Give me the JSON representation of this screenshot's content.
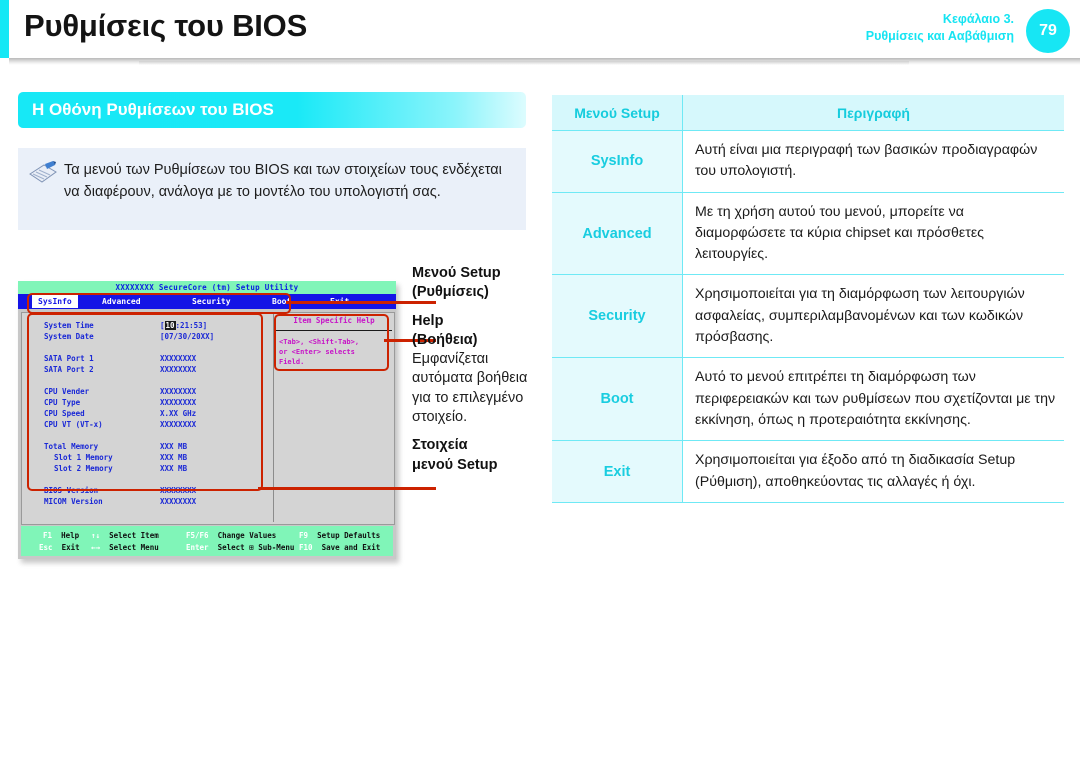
{
  "header": {
    "title": "Ρυθμίσεις του BIOS",
    "chapter": "Κεφάλαιο 3.",
    "subtitle": "Ρυθμίσεις και Ααβάθμιση",
    "page_number": "79",
    "accent_color": "#17e6f4"
  },
  "section": {
    "title": "Η Οθόνη Ρυθμίσεων του BIOS"
  },
  "note": {
    "icon": "note-pencil-icon",
    "text": "Τα μενού των Ρυθμίσεων του BIOS και των στοιχείων τους ενδέχεται να διαφέρουν, ανάλογα με το μοντέλο του υπολογιστή σας."
  },
  "bios": {
    "title": "XXXXXXXX SecureCore (tm) Setup Utility",
    "menu": [
      {
        "label": "SysInfo",
        "active": true
      },
      {
        "label": "Advanced",
        "active": false
      },
      {
        "label": "Security",
        "active": false
      },
      {
        "label": "Boot",
        "active": false
      },
      {
        "label": "Exit",
        "active": false
      }
    ],
    "help": {
      "title": "Item Specific Help",
      "line1": "<Tab>, <Shift-Tab>,",
      "line2": "or <Enter> selects",
      "line3": "Field."
    },
    "items": [
      {
        "label": "System Time",
        "value_pre": "[",
        "value_hl": "10",
        "value_post": ":21:53]",
        "indent": false
      },
      {
        "label": "System Date",
        "value": "[07/30/20XX]",
        "indent": false
      },
      {
        "label": "SATA Port 1",
        "value": "XXXXXXXX",
        "indent": false
      },
      {
        "label": "SATA Port 2",
        "value": "XXXXXXXX",
        "indent": false
      },
      {
        "label": "CPU Vender",
        "value": "XXXXXXXX",
        "indent": false
      },
      {
        "label": "CPU Type",
        "value": "XXXXXXXX",
        "indent": false
      },
      {
        "label": "CPU Speed",
        "value": "X.XX GHz",
        "indent": false
      },
      {
        "label": "CPU VT (VT-x)",
        "value": "XXXXXXXX",
        "indent": false
      },
      {
        "label": "Total Memory",
        "value": "XXX MB",
        "indent": false
      },
      {
        "label": "Slot 1 Memory",
        "value": "XXX MB",
        "indent": true
      },
      {
        "label": "Slot 2 Memory",
        "value": "XXX MB",
        "indent": true
      },
      {
        "label": "BIOS Version",
        "value": "XXXXXXXX",
        "indent": false
      },
      {
        "label": "MICOM Version",
        "value": "XXXXXXXX",
        "indent": false
      }
    ],
    "footer": [
      {
        "key": "F1",
        "desc": "Help"
      },
      {
        "key": "Esc",
        "desc": "Exit"
      },
      {
        "key": "↑↓",
        "desc": "Select Item"
      },
      {
        "key": "←→",
        "desc": "Select Menu"
      },
      {
        "key": "F5/F6",
        "desc": "Change Values"
      },
      {
        "key": "Enter",
        "desc": "Select ⊞ Sub-Menu"
      },
      {
        "key": "F9",
        "desc": "Setup Defaults"
      },
      {
        "key": "F10",
        "desc": "Save and Exit"
      }
    ]
  },
  "callouts": {
    "setup_menu_1": "Μενού Setup",
    "setup_menu_2": "(Ρυθμίσεις)",
    "help_1": "Help",
    "help_2": "(Βοήθεια)",
    "help_desc": "Εμφανίζεται αυτόματα βοήθεια για το επιλεγμένο στοιχείο.",
    "items_1": "Στοιχεία",
    "items_2": "μενού Setup"
  },
  "table": {
    "headers": [
      "Μενού Setup",
      "Περιγραφή"
    ],
    "rows": [
      {
        "menu": "SysInfo",
        "description": "Αυτή είναι μια περιγραφή των βασικών προδιαγραφών του υπολογιστή."
      },
      {
        "menu": "Advanced",
        "description": "Με τη χρήση αυτού του μενού, μπορείτε να διαμορφώσετε τα κύρια chipset και πρόσθετες λειτουργίες."
      },
      {
        "menu": "Security",
        "description": "Χρησιμοποιείται για τη διαμόρφωση των λειτουργιών ασφαλείας, συμπεριλαμβανομένων και των κωδικών πρόσβασης."
      },
      {
        "menu": "Boot",
        "description": "Αυτό το μενού επιτρέπει τη διαμόρφωση των περιφερειακών και των ρυθμίσεων που σχετίζονται με την εκκίνηση, όπως η προτεραιότητα εκκίνησης."
      },
      {
        "menu": "Exit",
        "description": "Χρησιμοποιείται για έξοδο από τη διαδικασία Setup (Ρύθμιση), αποθηκεύοντας τις αλλαγές ή όχι."
      }
    ]
  }
}
